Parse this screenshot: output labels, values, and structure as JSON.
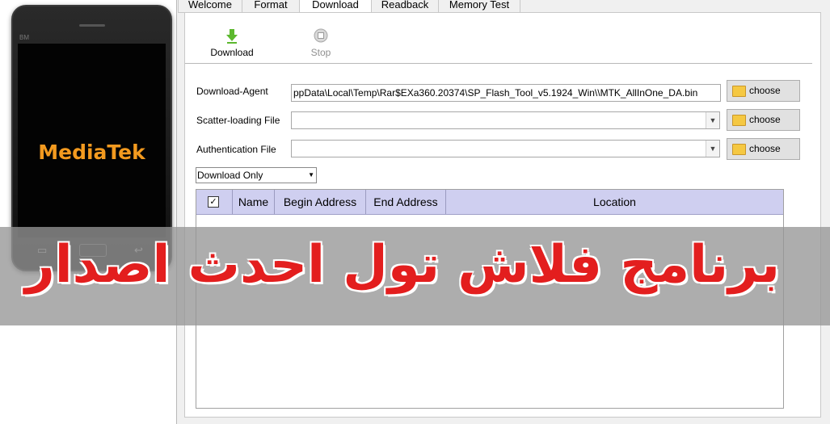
{
  "phone": {
    "brand_small": "BM",
    "logo": "MediaTek",
    "keys": [
      "▭",
      "↩"
    ],
    "logo_color": "#f39a1f"
  },
  "tabs": [
    "Welcome",
    "Format",
    "Download",
    "Readback",
    "Memory Test"
  ],
  "active_tab": "Download",
  "toolbar": {
    "download_label": "Download",
    "download_icon": "green-down-arrow-icon",
    "stop_label": "Stop",
    "stop_icon": "stop-icon"
  },
  "fields": {
    "agent_label": "Download-Agent",
    "agent_value": "ppData\\Local\\Temp\\Rar$EXa360.20374\\SP_Flash_Tool_v5.1924_Win\\\\MTK_AllInOne_DA.bin",
    "scatter_label": "Scatter-loading File",
    "scatter_value": "",
    "auth_label": "Authentication File",
    "auth_value": "",
    "choose_label": "choose"
  },
  "mode": {
    "selected": "Download Only"
  },
  "table": {
    "checkbox": "✓",
    "columns": [
      "Name",
      "Begin Address",
      "End Address",
      "Location"
    ],
    "header_color": "#cfcff0"
  },
  "banner": {
    "text": "برنامج فلاش تول احدث اصدار",
    "text_color": "#e31e1e"
  }
}
